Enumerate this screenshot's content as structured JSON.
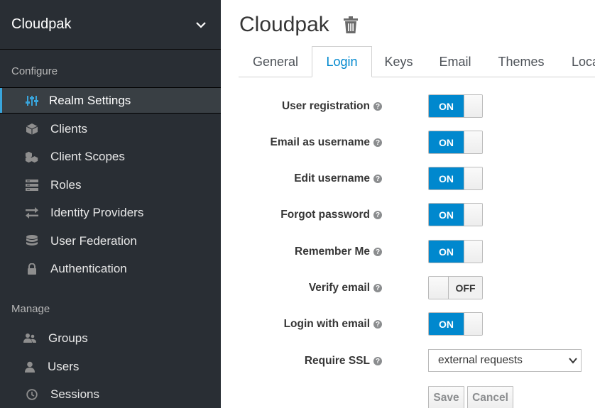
{
  "sidebar": {
    "realm": "Cloudpak",
    "configure_title": "Configure",
    "manage_title": "Manage",
    "configure_items": [
      {
        "label": "Realm Settings",
        "icon": "sliders-icon",
        "active": true
      },
      {
        "label": "Clients",
        "icon": "cube-icon"
      },
      {
        "label": "Client Scopes",
        "icon": "cubes-icon"
      },
      {
        "label": "Roles",
        "icon": "roles-list-icon"
      },
      {
        "label": "Identity Providers",
        "icon": "exchange-icon"
      },
      {
        "label": "User Federation",
        "icon": "database-icon"
      },
      {
        "label": "Authentication",
        "icon": "lock-icon"
      }
    ],
    "manage_items": [
      {
        "label": "Groups",
        "icon": "users-group-icon"
      },
      {
        "label": "Users",
        "icon": "user-icon"
      },
      {
        "label": "Sessions",
        "icon": "clock-icon"
      }
    ]
  },
  "main": {
    "title": "Cloudpak",
    "tabs": [
      {
        "label": "General"
      },
      {
        "label": "Login",
        "active": true
      },
      {
        "label": "Keys"
      },
      {
        "label": "Email"
      },
      {
        "label": "Themes"
      },
      {
        "label": "Loca"
      }
    ],
    "settings": [
      {
        "label": "User registration",
        "value": "ON"
      },
      {
        "label": "Email as username",
        "value": "ON"
      },
      {
        "label": "Edit username",
        "value": "ON"
      },
      {
        "label": "Forgot password",
        "value": "ON"
      },
      {
        "label": "Remember Me",
        "value": "ON"
      },
      {
        "label": "Verify email",
        "value": "OFF"
      },
      {
        "label": "Login with email",
        "value": "ON"
      }
    ],
    "require_ssl": {
      "label": "Require SSL",
      "value": "external requests"
    },
    "save_label": "Save",
    "cancel_label": "Cancel"
  },
  "colors": {
    "accent": "#0088ce",
    "sidebar_bg": "#292e34",
    "active_bar": "#39a5dc"
  }
}
